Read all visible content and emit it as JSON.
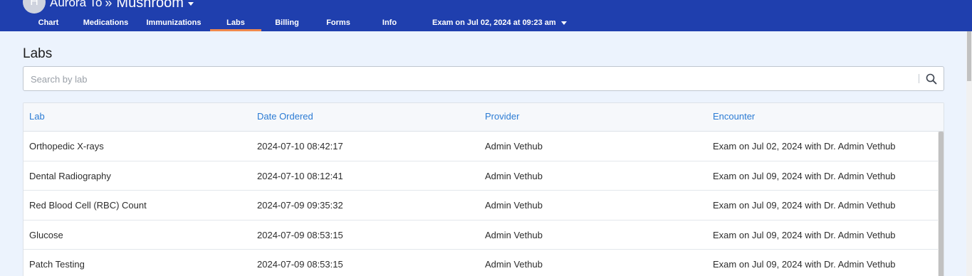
{
  "header": {
    "avatar_initial": "H",
    "client_name": "Aurora To",
    "separator": "»",
    "patient_name": "Mushroom",
    "tabs": [
      {
        "label": "Chart"
      },
      {
        "label": "Medications"
      },
      {
        "label": "Immunizations"
      },
      {
        "label": "Labs"
      },
      {
        "label": "Billing"
      },
      {
        "label": "Forms"
      },
      {
        "label": "Info"
      }
    ],
    "active_tab": "Labs",
    "encounter_select": "Exam on Jul 02, 2024 at 09:23 am"
  },
  "page": {
    "title": "Labs"
  },
  "search": {
    "placeholder": "Search by lab",
    "value": ""
  },
  "table": {
    "columns": [
      "Lab",
      "Date Ordered",
      "Provider",
      "Encounter"
    ],
    "rows": [
      [
        "Orthopedic X-rays",
        "2024-07-10 08:42:17",
        "Admin Vethub",
        "Exam on Jul 02, 2024 with Dr. Admin Vethub"
      ],
      [
        "Dental Radiography",
        "2024-07-10 08:12:41",
        "Admin Vethub",
        "Exam on Jul 09, 2024 with Dr. Admin Vethub"
      ],
      [
        "Red Blood Cell (RBC) Count",
        "2024-07-09 09:35:32",
        "Admin Vethub",
        "Exam on Jul 09, 2024 with Dr. Admin Vethub"
      ],
      [
        "Glucose",
        "2024-07-09 08:53:15",
        "Admin Vethub",
        "Exam on Jul 09, 2024 with Dr. Admin Vethub"
      ],
      [
        "Patch Testing",
        "2024-07-09 08:53:15",
        "Admin Vethub",
        "Exam on Jul 09, 2024 with Dr. Admin Vethub"
      ]
    ]
  },
  "icons": {
    "search": "search-icon",
    "dropdown": "chevron-down-icon"
  },
  "colors": {
    "header_bg": "#1f3fae",
    "active_tab_underline": "#f0894d",
    "page_bg": "#ecf3fd",
    "column_header_text": "#2b7bd4"
  }
}
